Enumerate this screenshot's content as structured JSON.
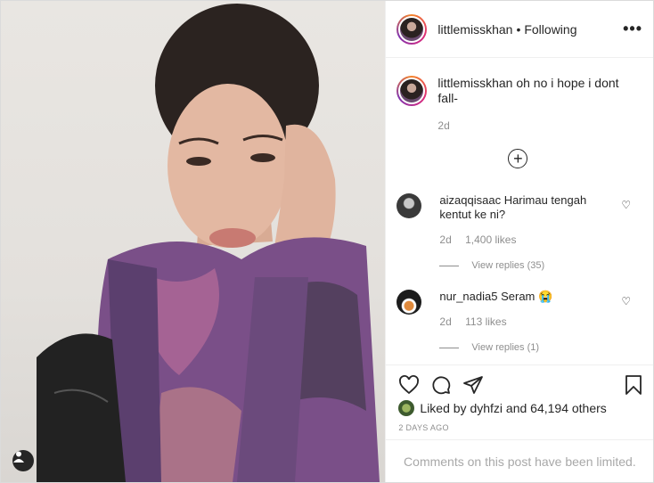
{
  "header": {
    "username": "littlemisskhan",
    "separator": "•",
    "follow_status": "Following",
    "more_label": "•••"
  },
  "caption": {
    "username": "littlemisskhan",
    "text": "oh no i hope i dont fall-",
    "age": "2d"
  },
  "load_more_label": "+",
  "comments": [
    {
      "username": "aizaqqisaac",
      "text": "Harimau tengah kentut ke ni?",
      "age": "2d",
      "likes": "1,400 likes",
      "replies": "View replies (35)"
    },
    {
      "username": "nur_nadia5",
      "text": "Seram 😭",
      "age": "2d",
      "likes": "113 likes",
      "replies": "View replies (1)"
    }
  ],
  "likes": {
    "prefix": "Liked by",
    "user": "dyhfzi",
    "middle": "and",
    "count": "64,194 others"
  },
  "post_date": "2 DAYS AGO",
  "comments_limited": "Comments on this post have been limited.",
  "icons": {
    "like": "heart-icon",
    "comment": "comment-icon",
    "share": "share-icon",
    "save": "bookmark-icon",
    "tag": "user-tag-icon"
  }
}
